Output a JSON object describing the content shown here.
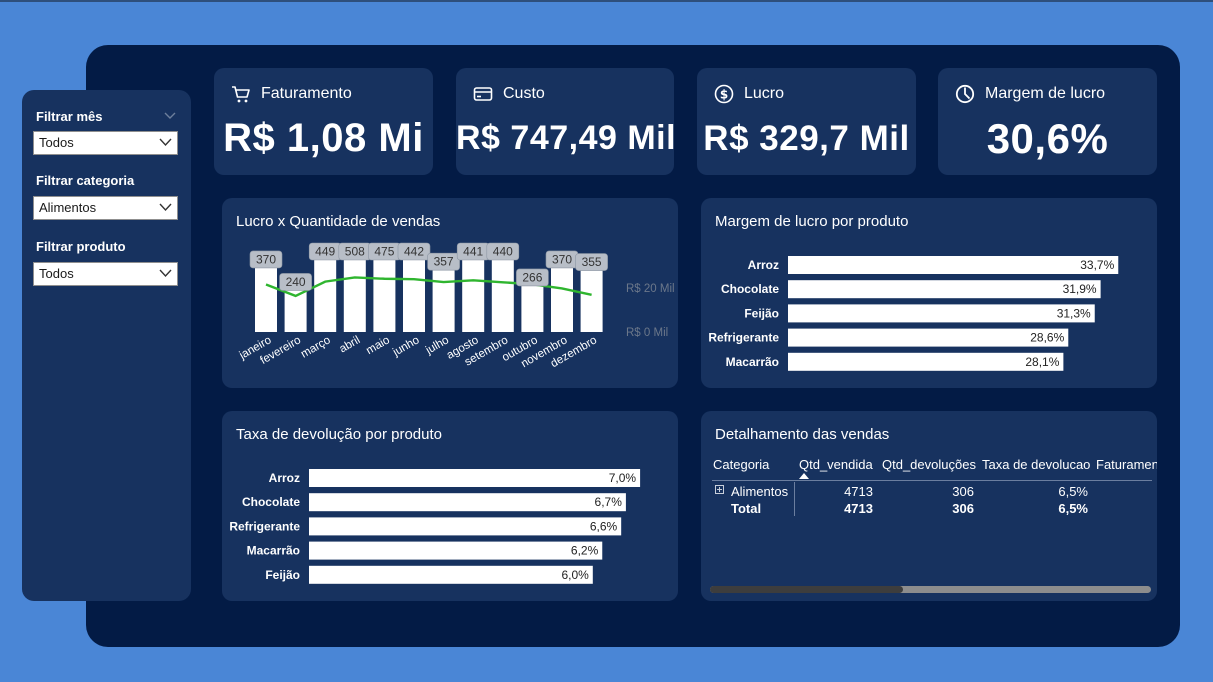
{
  "filters": {
    "month": {
      "label": "Filtrar mês",
      "value": "Todos"
    },
    "category": {
      "label": "Filtrar categoria",
      "value": "Alimentos"
    },
    "product": {
      "label": "Filtrar produto",
      "value": "Todos"
    }
  },
  "kpis": {
    "revenue": {
      "title": "Faturamento",
      "value": "R$ 1,08 Mi",
      "icon": "cart-icon"
    },
    "cost": {
      "title": "Custo",
      "value": "R$ 747,49 Mil",
      "icon": "credit-card-icon"
    },
    "profit": {
      "title": "Lucro",
      "value": "R$ 329,7 Mil",
      "icon": "dollar-circle-icon"
    },
    "margin": {
      "title": "Margem de lucro",
      "value": "30,6%",
      "icon": "pie-chart-icon"
    }
  },
  "colors": {
    "background": "#4a86d6",
    "panel": "#031b45",
    "card": "#17325f",
    "bar": "#ffffff",
    "line": "#2fb52f",
    "label_bubble": "#b8bec7"
  },
  "chart_data": [
    {
      "type": "bar",
      "title": "Lucro x Quantidade de vendas",
      "categories": [
        "janeiro",
        "fevereiro",
        "março",
        "abril",
        "maio",
        "junho",
        "julho",
        "agosto",
        "setembro",
        "outubro",
        "novembro",
        "dezembro"
      ],
      "series": [
        {
          "values": [
            370,
            240,
            449,
            508,
            475,
            442,
            357,
            441,
            440,
            266,
            370,
            355
          ]
        }
      ],
      "line_series": {
        "values": [
          21.6,
          16.4,
          22.9,
          24.8,
          24.2,
          24.0,
          22.7,
          23.5,
          22.6,
          21.7,
          19.8,
          16.9
        ]
      },
      "secondary_axis": {
        "ticks": [
          "R$ 20 Mil",
          "R$ 0 Mil"
        ],
        "tick_values": [
          20,
          0
        ]
      },
      "data_labels": [
        "370",
        "240",
        "449",
        "508",
        "475",
        "442",
        "357",
        "441",
        "440",
        "266",
        "370",
        "355"
      ]
    },
    {
      "type": "bar",
      "title": "Margem de lucro por produto",
      "categories": [
        "Arroz",
        "Chocolate",
        "Feijão",
        "Refrigerante",
        "Macarrão"
      ],
      "values": [
        33.7,
        31.9,
        31.3,
        28.6,
        28.1
      ],
      "data_labels": [
        "33,7%",
        "31,9%",
        "31,3%",
        "28,6%",
        "28,1%"
      ]
    },
    {
      "type": "bar",
      "title": "Taxa de devolução por produto",
      "categories": [
        "Arroz",
        "Chocolate",
        "Refrigerante",
        "Macarrão",
        "Feijão"
      ],
      "values": [
        7.0,
        6.7,
        6.6,
        6.2,
        6.0
      ],
      "data_labels": [
        "7,0%",
        "6,7%",
        "6,6%",
        "6,2%",
        "6,0%"
      ]
    }
  ],
  "table": {
    "title": "Detalhamento das vendas",
    "columns": [
      "Categoria",
      "Qtd_vendida",
      "Qtd_devoluções",
      "Taxa de devolucao",
      "Faturamen"
    ],
    "rows": [
      {
        "category": "Alimentos",
        "qty_sold": "4713",
        "qty_returns": "306",
        "return_rate": "6,5%"
      }
    ],
    "total": {
      "label": "Total",
      "qty_sold": "4713",
      "qty_returns": "306",
      "return_rate": "6,5%"
    }
  }
}
